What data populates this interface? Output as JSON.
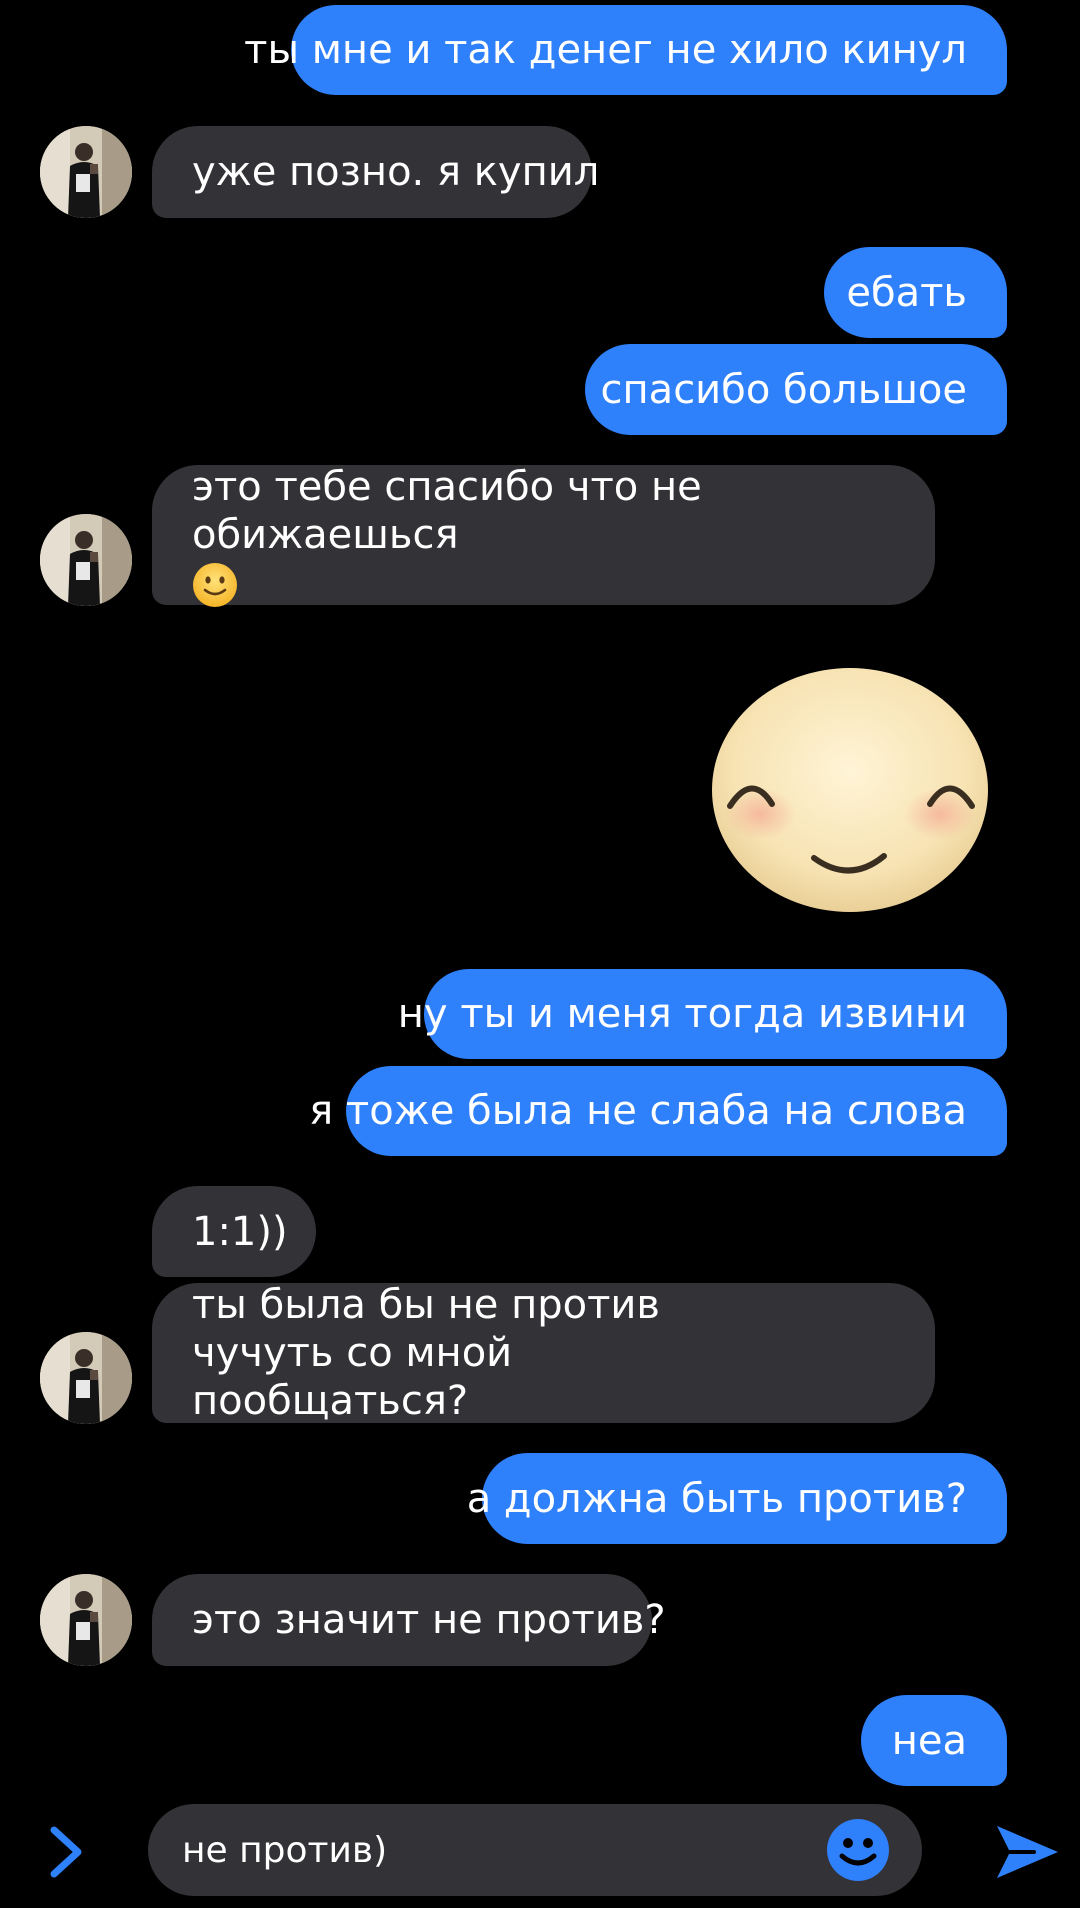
{
  "colors": {
    "background": "#000000",
    "outgoing_bubble": "#2f80fb",
    "incoming_bubble": "#333236",
    "accent": "#2f80fb",
    "text": "#ffffff"
  },
  "messages": [
    {
      "id": "m1",
      "direction": "outgoing",
      "text": "ты мне и так денег не хило кинул"
    },
    {
      "id": "m2",
      "direction": "incoming",
      "text": "уже позно. я купил"
    },
    {
      "id": "m3",
      "direction": "outgoing",
      "text": "ебать"
    },
    {
      "id": "m4",
      "direction": "outgoing",
      "text": "спасибо большое"
    },
    {
      "id": "m5",
      "direction": "incoming",
      "text": "это тебе спасибо что не обижаешься",
      "emoji": "slightly-smiling-face-icon"
    },
    {
      "id": "m6",
      "direction": "outgoing",
      "type": "sticker",
      "sticker": "smiling-face-sticker"
    },
    {
      "id": "m7",
      "direction": "outgoing",
      "text": "ну ты и меня тогда извини"
    },
    {
      "id": "m8",
      "direction": "outgoing",
      "text": "я тоже была не слаба на слова"
    },
    {
      "id": "m9",
      "direction": "incoming",
      "text": "1:1))"
    },
    {
      "id": "m10",
      "direction": "incoming",
      "text": "ты была бы не против чучуть со мной пообщаться?"
    },
    {
      "id": "m11",
      "direction": "outgoing",
      "text": "а должна быть против?"
    },
    {
      "id": "m12",
      "direction": "incoming",
      "text": "это значит не против?"
    },
    {
      "id": "m13",
      "direction": "outgoing",
      "text": "неа"
    }
  ],
  "composer": {
    "value": "не против)",
    "expand_icon": "chevron-right-icon",
    "emoji_icon": "smiley-icon",
    "send_icon": "send-arrow-icon"
  }
}
